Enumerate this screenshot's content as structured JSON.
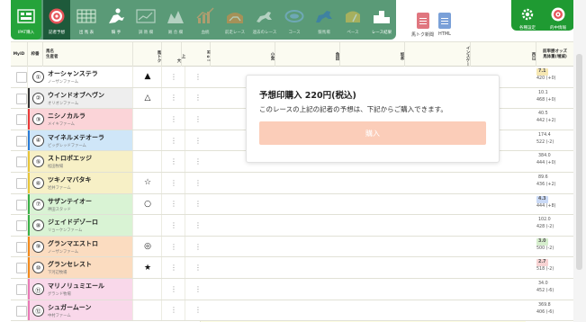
{
  "toolbar": {
    "items": [
      {
        "label": "IPAT購入",
        "icon": "ipat-icon"
      },
      {
        "label": "記者予想",
        "icon": "target-icon"
      },
      {
        "label": "出 馬 表",
        "icon": "grid-table-icon"
      },
      {
        "label": "騎 手",
        "icon": "jockey-icon"
      },
      {
        "label": "調 教 欄",
        "icon": "training-chart-icon"
      },
      {
        "label": "厩 舎 欄",
        "icon": "stable-icon"
      },
      {
        "label": "血統",
        "icon": "bar-graph-icon"
      },
      {
        "label": "前走レース",
        "icon": "race-horse-icon"
      },
      {
        "label": "過去のレース",
        "icon": "running-horse-icon"
      },
      {
        "label": "コース",
        "icon": "course-icon"
      },
      {
        "label": "競馬場",
        "icon": "racehorse-icon"
      },
      {
        "label": "ペース",
        "icon": "pace-icon"
      },
      {
        "label": "レース結果",
        "icon": "podium-icon"
      }
    ],
    "docs": [
      {
        "label": "馬トク新聞",
        "icon": "pdf-doc-icon",
        "color": "#e0767f"
      },
      {
        "label": "HTML",
        "icon": "html-doc-icon",
        "color": "#7aa0d8"
      }
    ],
    "right_buttons": [
      {
        "label": "各種設定",
        "icon": "gear-icon"
      },
      {
        "label": "的中情報",
        "icon": "hit-target-icon"
      }
    ]
  },
  "header": {
    "myid": "MyID",
    "gate": "枠番",
    "horse": "馬名",
    "breeder": "生産者",
    "mark": "馬トク",
    "col_big": "大",
    "col_up": "上",
    "col_ho": "H o !",
    "reporters": [
      "小宮",
      "角田",
      "坂本",
      "インスケー",
      "西山"
    ],
    "odds_title": "前単勝オッズ",
    "odds_sub": "馬体重(増減)"
  },
  "rows": [
    {
      "no": "①",
      "name": "オーシャンステラ",
      "farm": "ノーザンファーム",
      "mark": "▲",
      "odds": "7.1",
      "weight": "420 (+0)",
      "bg": "#ffffff",
      "gate": "#ffffff",
      "badge": "#f6e7b2"
    },
    {
      "no": "②",
      "name": "ウインドオブヘヴン",
      "farm": "オリオンファーム",
      "mark": "△",
      "odds": "10.1",
      "weight": "468 (+0)",
      "bg": "#eeeeee",
      "gate": "#333333",
      "badge": ""
    },
    {
      "no": "③",
      "name": "ニシノカルラ",
      "farm": "メイキファーム",
      "mark": "",
      "odds": "40.5",
      "weight": "442 (+2)",
      "bg": "#fbd4d8",
      "gate": "#e83a3a",
      "badge": ""
    },
    {
      "no": "④",
      "name": "マイネルメテオーラ",
      "farm": "ビッグレッドファーム",
      "mark": "",
      "odds": "174.4",
      "weight": "522 (-2)",
      "bg": "#cfe6f8",
      "gate": "#2b7bd6",
      "badge": ""
    },
    {
      "no": "⑤",
      "name": "ストロボエッジ",
      "farm": "松田牧場",
      "mark": "",
      "odds": "384.0",
      "weight": "444 (+0)",
      "bg": "#f7f0c6",
      "gate": "#e8c53a",
      "badge": ""
    },
    {
      "no": "⑥",
      "name": "ツキノマバタキ",
      "farm": "岩井ファーム",
      "mark": "☆",
      "odds": "89.6",
      "weight": "436 (+2)",
      "bg": "#f7f0c6",
      "gate": "#e8c53a",
      "badge": ""
    },
    {
      "no": "⑦",
      "name": "サザンテイオー",
      "farm": "神田スタッド",
      "mark": "○",
      "odds": "4.3",
      "weight": "444 (+8)",
      "bg": "#d9f3d4",
      "gate": "#3cb04a",
      "badge": "#c9d9f6"
    },
    {
      "no": "⑧",
      "name": "ジェイドデゾーロ",
      "farm": "リョーケンファーム",
      "mark": "",
      "odds": "102.0",
      "weight": "428 (-2)",
      "bg": "#d9f3d4",
      "gate": "#3cb04a",
      "badge": ""
    },
    {
      "no": "⑨",
      "name": "グランマエストロ",
      "farm": "ノーザンファーム",
      "mark": "◎",
      "odds": "3.0",
      "weight": "500 (-2)",
      "bg": "#fbdcc0",
      "gate": "#f28a1e",
      "badge": "#d6eecd"
    },
    {
      "no": "⑩",
      "name": "グランセレスト",
      "farm": "下河辺牧場",
      "mark": "★",
      "odds": "2.7",
      "weight": "518 (-2)",
      "bg": "#fbdcc0",
      "gate": "#f28a1e",
      "badge": "#f8d3d3"
    },
    {
      "no": "⑪",
      "name": "マリノリュミエール",
      "farm": "グランド牧場",
      "mark": "",
      "odds": "34.0",
      "weight": "452 (-6)",
      "bg": "#f9d8ea",
      "gate": "#e87ab8",
      "badge": ""
    },
    {
      "no": "⑫",
      "name": "シュガームーン",
      "farm": "中村ファーム",
      "mark": "",
      "odds": "369.8",
      "weight": "406 (-6)",
      "bg": "#f9d8ea",
      "gate": "#e87ab8",
      "badge": ""
    }
  ],
  "purchase": {
    "title": "予想印購入 220円(税込)",
    "text": "このレースの上記の記者の予想は、下記からご購入できます。",
    "button": "購入"
  }
}
